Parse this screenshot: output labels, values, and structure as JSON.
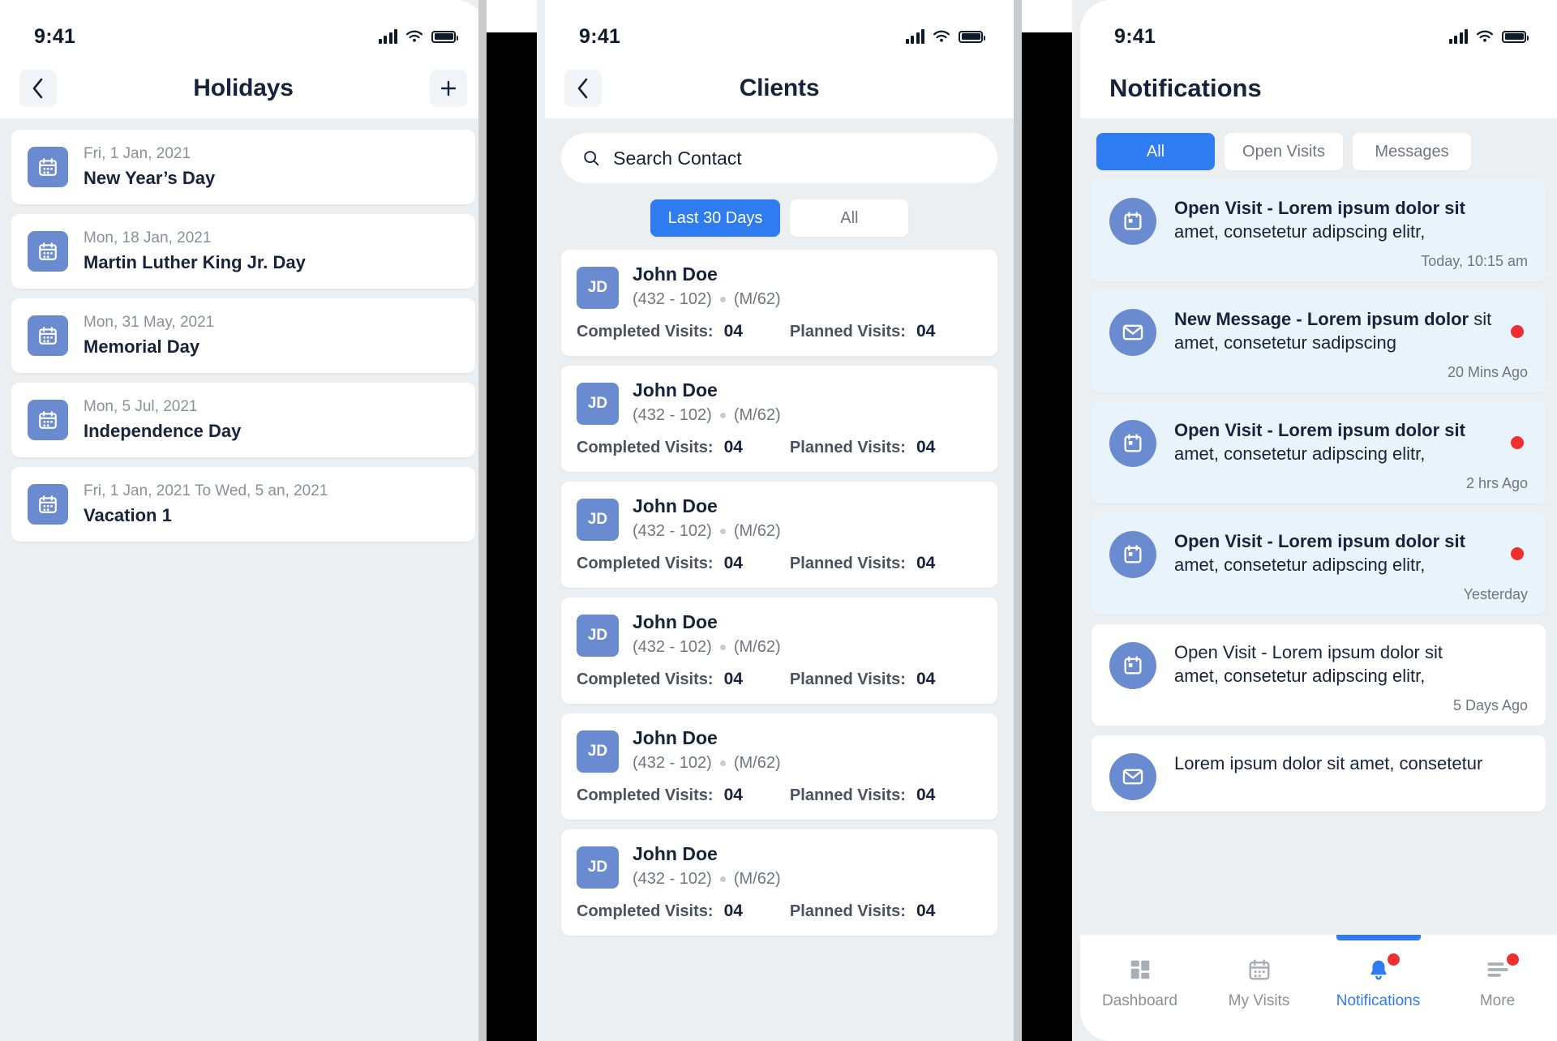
{
  "statusbar": {
    "time": "9:41"
  },
  "screen_holidays": {
    "title": "Holidays",
    "back_icon": "chevron-left-icon",
    "add_icon": "plus-icon",
    "items": [
      {
        "date": "Fri, 1 Jan, 2021",
        "name": "New Year’s Day"
      },
      {
        "date": "Mon, 18 Jan, 2021",
        "name": "Martin Luther King Jr. Day"
      },
      {
        "date": "Mon, 31 May, 2021",
        "name": "Memorial Day"
      },
      {
        "date": "Mon, 5 Jul, 2021",
        "name": "Independence Day"
      },
      {
        "date": "Fri, 1 Jan, 2021 To Wed, 5 an, 2021",
        "name": "Vacation 1"
      }
    ]
  },
  "screen_clients": {
    "title": "Clients",
    "back_icon": "chevron-left-icon",
    "search": {
      "placeholder": "Search Contact",
      "value": "",
      "icon": "search-icon"
    },
    "filters": [
      {
        "label": "Last 30 Days",
        "active": true
      },
      {
        "label": "All",
        "active": false
      }
    ],
    "labels": {
      "completed": "Completed Visits:",
      "planned": "Planned Visits:"
    },
    "clients": [
      {
        "initials": "JD",
        "name": "John Doe",
        "ids": "(432 - 102)",
        "demo": "(M/62)",
        "completed": "04",
        "planned": "04"
      },
      {
        "initials": "JD",
        "name": "John Doe",
        "ids": "(432 - 102)",
        "demo": "(M/62)",
        "completed": "04",
        "planned": "04"
      },
      {
        "initials": "JD",
        "name": "John Doe",
        "ids": "(432 - 102)",
        "demo": "(M/62)",
        "completed": "04",
        "planned": "04"
      },
      {
        "initials": "JD",
        "name": "John Doe",
        "ids": "(432 - 102)",
        "demo": "(M/62)",
        "completed": "04",
        "planned": "04"
      },
      {
        "initials": "JD",
        "name": "John Doe",
        "ids": "(432 - 102)",
        "demo": "(M/62)",
        "completed": "04",
        "planned": "04"
      },
      {
        "initials": "JD",
        "name": "John Doe",
        "ids": "(432 - 102)",
        "demo": "(M/62)",
        "completed": "04",
        "planned": "04"
      }
    ]
  },
  "screen_notifications": {
    "title": "Notifications",
    "filters": [
      {
        "label": "All",
        "active": true
      },
      {
        "label": "Open Visits",
        "active": false
      },
      {
        "label": "Messages",
        "active": false
      }
    ],
    "items": [
      {
        "icon": "calendar-icon",
        "bold_text": "Open Visit - Lorem ipsum dolor sit",
        "rest_text": "amet, consetetur adipscing elitr,",
        "time": "Today, 10:15 am",
        "unread": true,
        "dot": false
      },
      {
        "icon": "envelope-icon",
        "bold_text": "New Message - Lorem ipsum dolor",
        "rest_text": "sit amet, consetetur sadipscing",
        "time": "20 Mins Ago",
        "unread": true,
        "dot": true
      },
      {
        "icon": "calendar-icon",
        "bold_text": "Open Visit - Lorem ipsum dolor sit",
        "rest_text": "amet, consetetur adipscing elitr,",
        "time": "2 hrs Ago",
        "unread": true,
        "dot": true
      },
      {
        "icon": "calendar-icon",
        "bold_text": "Open Visit - Lorem ipsum dolor sit",
        "rest_text": "amet, consetetur adipscing elitr,",
        "time": "Yesterday",
        "unread": true,
        "dot": true
      },
      {
        "icon": "calendar-icon",
        "bold_text": "",
        "rest_text": "Open Visit - Lorem ipsum dolor sit amet, consetetur adipscing elitr,",
        "time": "5 Days Ago",
        "unread": false,
        "dot": false
      },
      {
        "icon": "envelope-icon",
        "bold_text": "",
        "rest_text": "Lorem ipsum dolor sit amet, consetetur",
        "time": "",
        "unread": false,
        "dot": false
      }
    ],
    "tabbar": [
      {
        "label": "Dashboard",
        "icon": "grid-icon",
        "active": false,
        "dot": false
      },
      {
        "label": "My Visits",
        "icon": "calendar-icon",
        "active": false,
        "dot": false
      },
      {
        "label": "Notifications",
        "icon": "bell-icon",
        "active": true,
        "dot": true
      },
      {
        "label": "More",
        "icon": "menu-icon",
        "active": false,
        "dot": true
      }
    ]
  },
  "colors": {
    "accent": "#2f7bf0",
    "icon_blue": "#6a8bcf",
    "unread_bg": "#e9f3fc",
    "badge_red": "#f03030",
    "page_bg": "#eceff1"
  }
}
